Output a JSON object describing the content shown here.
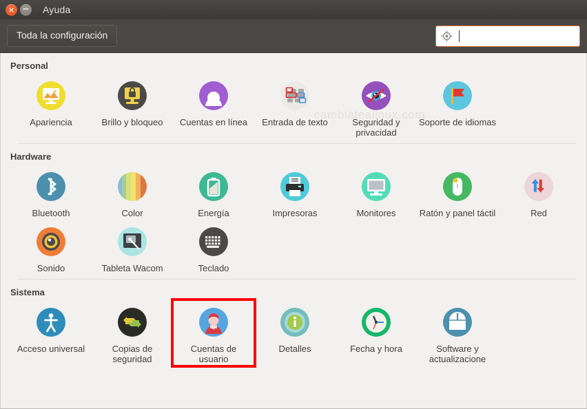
{
  "window": {
    "title": "Ayuda",
    "close_glyph": "×",
    "minimize_glyph": "−",
    "close_icon": "close-icon",
    "minimize_icon": "minimize-icon"
  },
  "toolbar": {
    "all_settings_label": "Toda la configuración",
    "search": {
      "value": "",
      "placeholder": "",
      "icon": "search-target-icon"
    }
  },
  "watermark": "cambiatealinux.com",
  "colors": {
    "accent_orange": "#e06a33",
    "highlight_red": "#ff0000",
    "titlebar": "#413f3b",
    "content_bg": "#f2f1ef",
    "label_text": "#40403e"
  },
  "sections": [
    {
      "title": "Personal",
      "rows": [
        [
          {
            "label": "Apariencia",
            "icon": "appearance-icon"
          },
          {
            "label": "Brillo y bloqueo",
            "icon": "brightness-lock-icon"
          },
          {
            "label": "Cuentas en línea",
            "icon": "online-accounts-icon"
          },
          {
            "label": "Entrada de texto",
            "icon": "text-entry-icon"
          },
          {
            "label": "Seguridad y privacidad",
            "icon": "security-privacy-icon"
          },
          {
            "label": "Soporte de idiomas",
            "icon": "language-support-icon"
          }
        ]
      ]
    },
    {
      "title": "Hardware",
      "rows": [
        [
          {
            "label": "Bluetooth",
            "icon": "bluetooth-icon"
          },
          {
            "label": "Color",
            "icon": "color-icon"
          },
          {
            "label": "Energía",
            "icon": "power-icon"
          },
          {
            "label": "Impresoras",
            "icon": "printers-icon"
          },
          {
            "label": "Monitores",
            "icon": "displays-icon"
          },
          {
            "label": "Ratón y panel táctil",
            "icon": "mouse-touchpad-icon"
          },
          {
            "label": "Red",
            "icon": "network-icon"
          }
        ],
        [
          {
            "label": "Sonido",
            "icon": "sound-icon"
          },
          {
            "label": "Tableta Wacom",
            "icon": "wacom-tablet-icon"
          },
          {
            "label": "Teclado",
            "icon": "keyboard-icon"
          }
        ]
      ]
    },
    {
      "title": "Sistema",
      "rows": [
        [
          {
            "label": "Acceso universal",
            "icon": "universal-access-icon"
          },
          {
            "label": "Copias de seguridad",
            "icon": "backups-icon"
          },
          {
            "label": "Cuentas de usuario",
            "icon": "user-accounts-icon",
            "selected": true
          },
          {
            "label": "Detalles",
            "icon": "details-icon"
          },
          {
            "label": "Fecha y hora",
            "icon": "date-time-icon"
          },
          {
            "label": "Software y actualizacione",
            "icon": "software-updates-icon"
          }
        ]
      ]
    }
  ]
}
